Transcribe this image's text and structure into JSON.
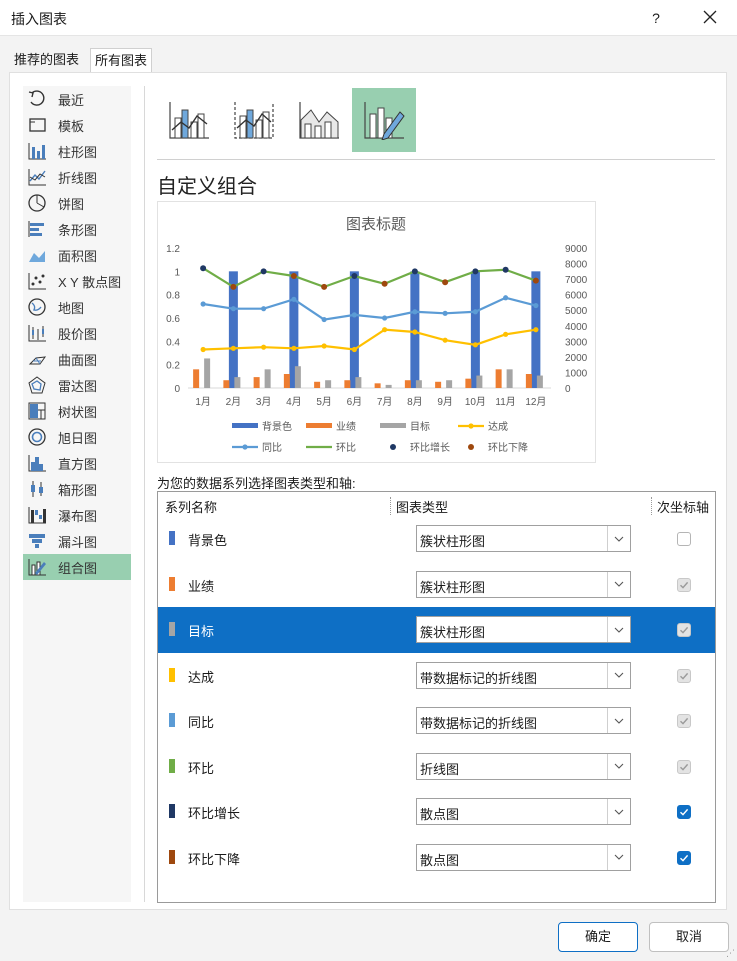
{
  "window": {
    "title": "插入图表",
    "help": "?"
  },
  "tabs": [
    "推荐的图表",
    "所有图表"
  ],
  "chart_types": [
    {
      "label": "最近",
      "icon": "recent-icon"
    },
    {
      "label": "模板",
      "icon": "template-icon"
    },
    {
      "label": "柱形图",
      "icon": "column-chart-icon"
    },
    {
      "label": "折线图",
      "icon": "line-chart-icon"
    },
    {
      "label": "饼图",
      "icon": "pie-chart-icon"
    },
    {
      "label": "条形图",
      "icon": "bar-chart-icon"
    },
    {
      "label": "面积图",
      "icon": "area-chart-icon"
    },
    {
      "label": "X Y 散点图",
      "icon": "scatter-chart-icon"
    },
    {
      "label": "地图",
      "icon": "map-chart-icon"
    },
    {
      "label": "股价图",
      "icon": "stock-chart-icon"
    },
    {
      "label": "曲面图",
      "icon": "surface-chart-icon"
    },
    {
      "label": "雷达图",
      "icon": "radar-chart-icon"
    },
    {
      "label": "树状图",
      "icon": "treemap-chart-icon"
    },
    {
      "label": "旭日图",
      "icon": "sunburst-chart-icon"
    },
    {
      "label": "直方图",
      "icon": "histogram-chart-icon"
    },
    {
      "label": "箱形图",
      "icon": "box-whisker-chart-icon"
    },
    {
      "label": "瀑布图",
      "icon": "waterfall-chart-icon"
    },
    {
      "label": "漏斗图",
      "icon": "funnel-chart-icon"
    },
    {
      "label": "组合图",
      "icon": "combo-chart-icon"
    }
  ],
  "selected_chart_type": "组合图",
  "subtypes": [
    {
      "icon": "clustered-column-line-icon"
    },
    {
      "icon": "clustered-column-line-secondary-axis-icon"
    },
    {
      "icon": "stacked-area-clustered-column-icon"
    },
    {
      "icon": "custom-combination-icon"
    }
  ],
  "heading": "自定义组合",
  "preview": {
    "chart_data": {
      "type": "combo",
      "title": "图表标题",
      "categories": [
        "1月",
        "2月",
        "3月",
        "4月",
        "5月",
        "6月",
        "7月",
        "8月",
        "9月",
        "10月",
        "11月",
        "12月"
      ],
      "y_left": {
        "range": [
          0,
          1.2
        ],
        "ticks": [
          "0",
          "0.2",
          "0.4",
          "0.6",
          "0.8",
          "1",
          "1.2"
        ]
      },
      "y_right": {
        "range": [
          0,
          9000
        ],
        "ticks": [
          "0",
          "1000",
          "2000",
          "3000",
          "4000",
          "5000",
          "6000",
          "7000",
          "8000",
          "9000"
        ]
      },
      "series": [
        {
          "name": "背景色",
          "kind": "column",
          "axis": "left",
          "color": "#4472c4",
          "values": [
            0,
            1,
            0,
            1,
            0,
            1,
            0,
            1,
            0,
            1,
            0,
            1
          ]
        },
        {
          "name": "业绩",
          "kind": "column",
          "axis": "right",
          "color": "#ed7d31",
          "values": [
            1200,
            500,
            700,
            900,
            400,
            500,
            300,
            500,
            400,
            600,
            1200,
            900
          ]
        },
        {
          "name": "目标",
          "kind": "column",
          "axis": "right",
          "color": "#a5a5a5",
          "values": [
            1900,
            700,
            1200,
            1400,
            500,
            700,
            200,
            500,
            500,
            800,
            1200,
            800
          ]
        },
        {
          "name": "达成",
          "kind": "line-marker",
          "axis": "left",
          "color": "#ffc000",
          "values": [
            0.33,
            0.34,
            0.35,
            0.34,
            0.36,
            0.33,
            0.5,
            0.48,
            0.41,
            0.37,
            0.46,
            0.5
          ]
        },
        {
          "name": "同比",
          "kind": "line-marker",
          "axis": "right",
          "color": "#5b9bd5",
          "values": [
            5400,
            5100,
            5100,
            5700,
            4400,
            4700,
            4500,
            4900,
            4800,
            4900,
            5800,
            5300
          ]
        },
        {
          "name": "环比",
          "kind": "line",
          "axis": "right",
          "color": "#70ad47",
          "values": [
            7700,
            6500,
            7500,
            7200,
            6500,
            7200,
            6700,
            7500,
            6800,
            7500,
            7600,
            6900
          ]
        },
        {
          "name": "环比增长",
          "kind": "scatter",
          "axis": "right",
          "color": "#1f3864",
          "values": [
            7700,
            null,
            7500,
            null,
            null,
            7200,
            null,
            7500,
            null,
            7500,
            7600,
            null
          ]
        },
        {
          "name": "环比下降",
          "kind": "scatter",
          "axis": "right",
          "color": "#9e480e",
          "values": [
            null,
            6500,
            null,
            7200,
            6500,
            null,
            6700,
            null,
            6800,
            null,
            null,
            6900
          ]
        }
      ],
      "legend": "bottom"
    }
  },
  "series_prompt": "为您的数据系列选择图表类型和轴:",
  "grid": {
    "headers": {
      "name": "系列名称",
      "type": "图表类型",
      "secondary": "次坐标轴"
    },
    "rows": [
      {
        "name": "背景色",
        "color": "#4472c4",
        "type": "簇状柱形图",
        "secondary": "unchecked"
      },
      {
        "name": "业绩",
        "color": "#ed7d31",
        "type": "簇状柱形图",
        "secondary": "checked-disabled"
      },
      {
        "name": "目标",
        "color": "#a5a5a5",
        "type": "簇状柱形图",
        "secondary": "checked-disabled",
        "selected": true
      },
      {
        "name": "达成",
        "color": "#ffc000",
        "type": "带数据标记的折线图",
        "secondary": "checked-disabled"
      },
      {
        "name": "同比",
        "color": "#5b9bd5",
        "type": "带数据标记的折线图",
        "secondary": "checked-disabled"
      },
      {
        "name": "环比",
        "color": "#70ad47",
        "type": "折线图",
        "secondary": "checked-disabled"
      },
      {
        "name": "环比增长",
        "color": "#1f3864",
        "type": "散点图",
        "secondary": "checked"
      },
      {
        "name": "环比下降",
        "color": "#9e480e",
        "type": "散点图",
        "secondary": "checked"
      }
    ]
  },
  "buttons": {
    "ok": "确定",
    "cancel": "取消"
  },
  "colors": {
    "accent": "#0e6fc5",
    "selected_bg": "#98cfb0"
  }
}
